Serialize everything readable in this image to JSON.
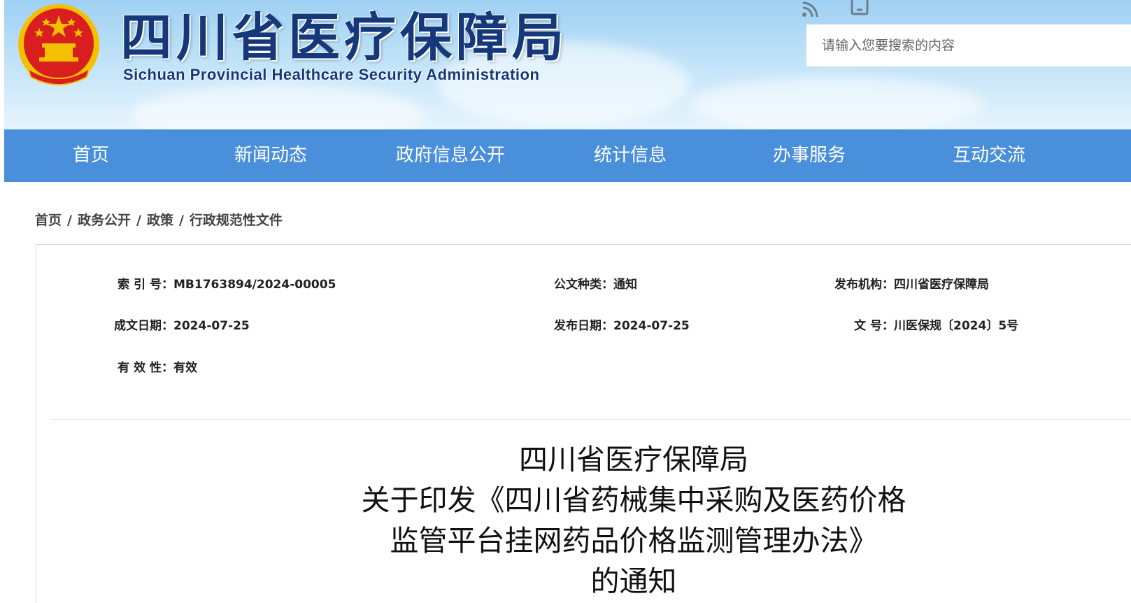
{
  "header": {
    "title": "四川省医疗保障局",
    "subtitle": "Sichuan Provincial Healthcare Security Administration",
    "search_placeholder": "请输入您要搜索的内容",
    "icons": [
      "rss-icon",
      "mobile-icon"
    ],
    "colors": {
      "title": "#14387a",
      "emblem_red": "#d81e1e",
      "emblem_gold": "#f5c000"
    }
  },
  "nav": {
    "items": [
      "首页",
      "新闻动态",
      "政府信息公开",
      "统计信息",
      "办事服务",
      "互动交流"
    ],
    "color": "#4a8fda"
  },
  "breadcrumb": {
    "items": [
      "首页",
      "政务公开",
      "政策",
      "行政规范性文件"
    ],
    "separator": "/"
  },
  "meta": {
    "index_label": "索 引 号：",
    "index_value": "MB1763894/2024-00005",
    "category_label": "公文种类：",
    "category_value": "通知",
    "issuer_label": "发布机构：",
    "issuer_value": "四川省医疗保障局",
    "created_label": "成文日期：",
    "created_value": "2024-07-25",
    "published_label": "发布日期：",
    "published_value": "2024-07-25",
    "docno_label": "文 号：",
    "docno_value": "川医保规〔2024〕5号",
    "validity_label": "有 效 性：",
    "validity_value": "有效"
  },
  "document": {
    "title_lines": [
      "四川省医疗保障局",
      "关于印发《四川省药械集中采购及医药价格",
      "监管平台挂网药品价格监测管理办法》",
      "的通知"
    ]
  }
}
